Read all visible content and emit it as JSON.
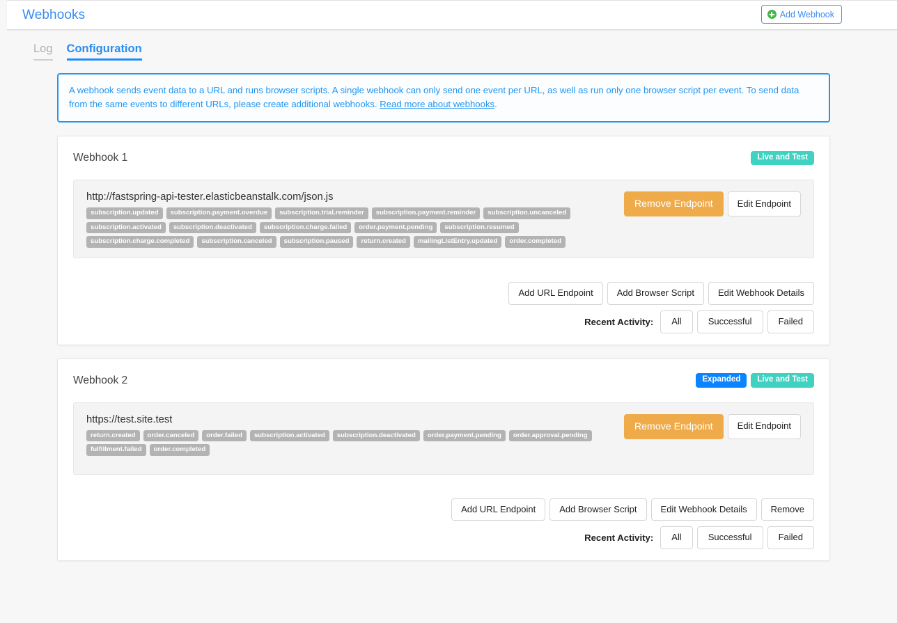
{
  "header": {
    "title": "Webhooks",
    "add_button_label": "Add Webhook",
    "add_button_icon": "plus-circle-icon",
    "accent_blue": "#3b8cf4",
    "plus_green": "#45b64a"
  },
  "tabs": [
    {
      "label": "Log",
      "active": false
    },
    {
      "label": "Configuration",
      "active": true
    }
  ],
  "banner": {
    "text_before_link": "A webhook sends event data to a URL and runs browser scripts. A single webhook can only send one event per URL, as well as run only one browser script per event. To send data from the same events to different URLs, please create additional webhooks. ",
    "link_text": "Read more about webhooks",
    "text_after_link": ".",
    "border_color": "#2196f3"
  },
  "common": {
    "remove_endpoint_label": "Remove Endpoint",
    "edit_endpoint_label": "Edit Endpoint",
    "add_url_endpoint_label": "Add URL Endpoint",
    "add_browser_script_label": "Add Browser Script",
    "edit_webhook_details_label": "Edit Webhook Details",
    "remove_label": "Remove",
    "recent_activity_label": "Recent Activity:",
    "activity_all_label": "All",
    "activity_successful_label": "Successful",
    "activity_failed_label": "Failed",
    "badge_live_color": "#3fd2c0",
    "badge_expanded_color": "#0a84ff",
    "remove_button_color": "#efab4a",
    "tag_color": "#b3b3b3"
  },
  "webhooks": [
    {
      "title": "Webhook 1",
      "badges": [
        {
          "label": "Live and Test",
          "type": "live"
        }
      ],
      "endpoint": {
        "url": "http://fastspring-api-tester.elasticbeanstalk.com/json.js",
        "events": [
          "subscription.updated",
          "subscription.payment.overdue",
          "subscription.trial.reminder",
          "subscription.payment.reminder",
          "subscription.uncanceled",
          "subscription.activated",
          "subscription.deactivated",
          "subscription.charge.failed",
          "order.payment.pending",
          "subscription.resumed",
          "subscription.charge.completed",
          "subscription.canceled",
          "subscription.paused",
          "return.created",
          "mailingListEntry.updated",
          "order.completed"
        ]
      },
      "has_remove_webhook": false
    },
    {
      "title": "Webhook 2",
      "badges": [
        {
          "label": "Expanded",
          "type": "expanded"
        },
        {
          "label": "Live and Test",
          "type": "live"
        }
      ],
      "endpoint": {
        "url": "https://test.site.test",
        "events": [
          "return.created",
          "order.canceled",
          "order.failed",
          "subscription.activated",
          "subscription.deactivated",
          "order.payment.pending",
          "order.approval.pending",
          "fulfillment.failed",
          "order.completed"
        ]
      },
      "has_remove_webhook": true
    }
  ]
}
